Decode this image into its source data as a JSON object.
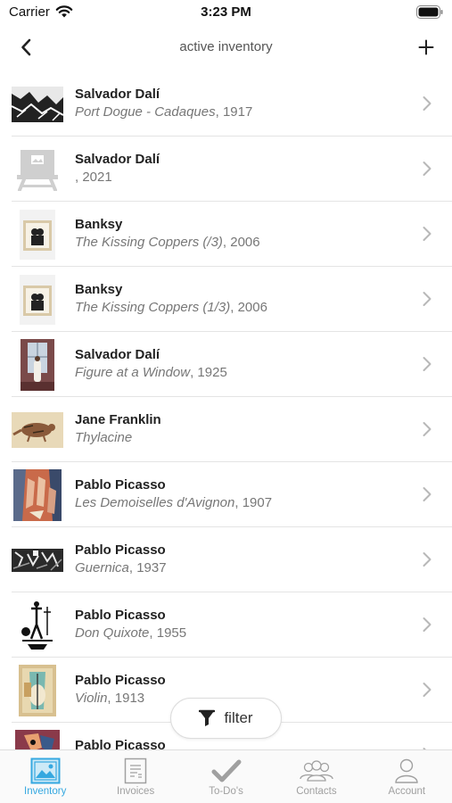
{
  "status_bar": {
    "carrier": "Carrier",
    "time": "3:23 PM"
  },
  "nav": {
    "title": "active inventory",
    "back_icon": "chevron-left-icon",
    "add_icon": "plus-icon"
  },
  "inventory": [
    {
      "artist": "Salvador Dalí",
      "title": "Port Dogue - Cadaques",
      "suffix": ", 1917",
      "thumb": "landscape-sketch"
    },
    {
      "artist": "Salvador Dalí",
      "title": "",
      "suffix": ", 2021",
      "thumb": "placeholder-easel"
    },
    {
      "artist": "Banksy",
      "title": "The Kissing Coppers (/3)",
      "suffix": ", 2006",
      "thumb": "framed-print"
    },
    {
      "artist": "Banksy",
      "title": "The Kissing Coppers (1/3)",
      "suffix": ", 2006",
      "thumb": "framed-print"
    },
    {
      "artist": "Salvador Dalí",
      "title": "Figure at a Window",
      "suffix": ", 1925",
      "thumb": "window-figure"
    },
    {
      "artist": "Jane Franklin",
      "title": "Thylacine",
      "suffix": "",
      "thumb": "animal-drawing"
    },
    {
      "artist": "Pablo Picasso",
      "title": "Les Demoiselles d'Avignon",
      "suffix": ", 1907",
      "thumb": "cubist-figures"
    },
    {
      "artist": "Pablo Picasso",
      "title": "Guernica",
      "suffix": ", 1937",
      "thumb": "monochrome-mural"
    },
    {
      "artist": "Pablo Picasso",
      "title": "Don Quixote",
      "suffix": ", 1955",
      "thumb": "ink-sketch"
    },
    {
      "artist": "Pablo Picasso",
      "title": "Violin",
      "suffix": ", 1913",
      "thumb": "collage"
    },
    {
      "artist": "Pablo Picasso",
      "title": "",
      "suffix": "",
      "thumb": "portrait"
    }
  ],
  "filter": {
    "label": "filter",
    "icon": "funnel-icon"
  },
  "tabs": [
    {
      "label": "Inventory",
      "icon": "picture-icon",
      "active": true
    },
    {
      "label": "Invoices",
      "icon": "document-icon",
      "active": false
    },
    {
      "label": "To-Do's",
      "icon": "checkmark-icon",
      "active": false
    },
    {
      "label": "Contacts",
      "icon": "people-icon",
      "active": false
    },
    {
      "label": "Account",
      "icon": "person-icon",
      "active": false
    }
  ],
  "colors": {
    "accent": "#35a8e0",
    "inactive": "#a0a0a0",
    "separator": "#e4e4e4"
  }
}
